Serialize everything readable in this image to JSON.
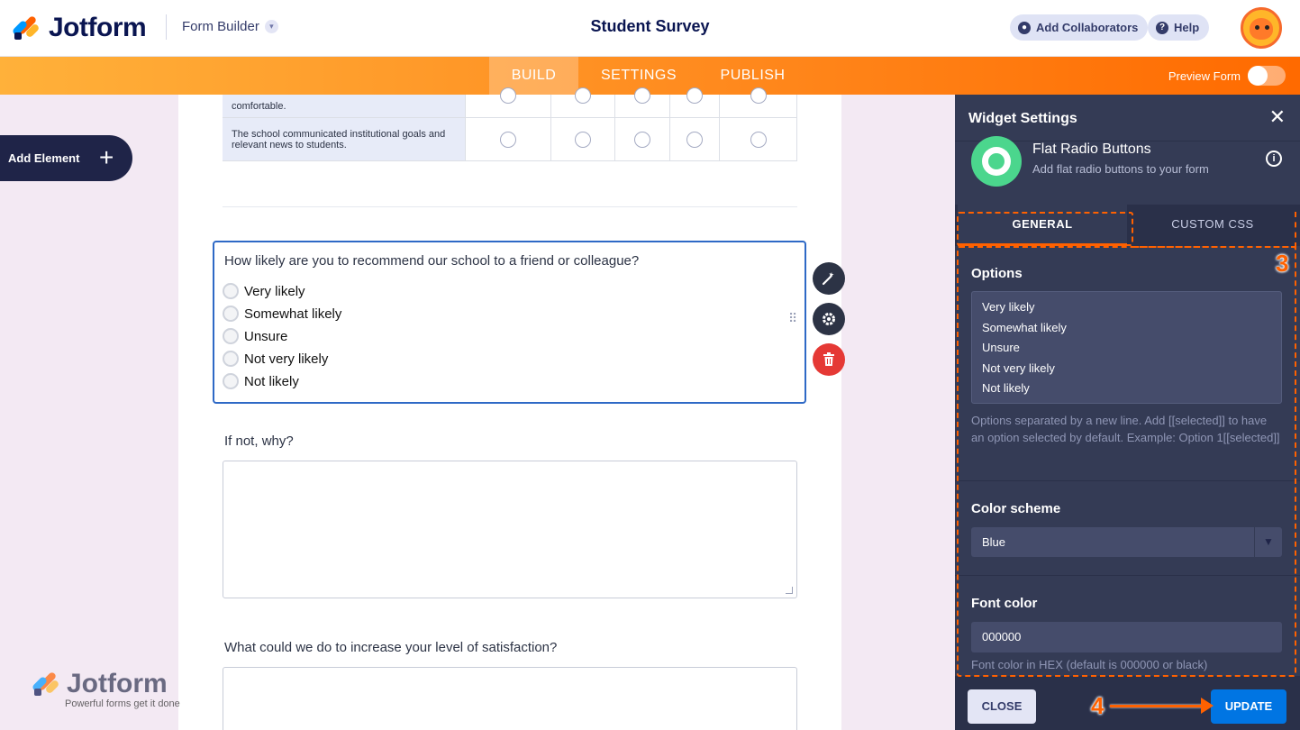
{
  "header": {
    "brand": "Jotform",
    "builder_label": "Form Builder",
    "form_title": "Student Survey",
    "add_collaborators": "Add Collaborators",
    "help": "Help"
  },
  "nav": {
    "build": "BUILD",
    "settings": "SETTINGS",
    "publish": "PUBLISH",
    "preview_form": "Preview Form"
  },
  "left_rail": {
    "add_element": "Add Element"
  },
  "form": {
    "matrix_rows": [
      "comfortable.",
      "The school communicated institutional goals and relevant news to students."
    ],
    "question": "How likely are you to recommend our school to a friend or colleague?",
    "options": [
      "Very likely",
      "Somewhat likely",
      "Unsure",
      "Not very likely",
      "Not likely"
    ],
    "q_if_not": "If not, why?",
    "q_increase": "What could we do to increase your level of satisfaction?"
  },
  "watermark": {
    "brand": "Jotform",
    "tagline": "Powerful forms get it done"
  },
  "panel": {
    "title": "Widget Settings",
    "widget_name": "Flat Radio Buttons",
    "widget_desc": "Add flat radio buttons to your form",
    "tab_general": "GENERAL",
    "tab_css": "CUSTOM CSS",
    "options_label": "Options",
    "options_values": [
      "Very likely",
      "Somewhat likely",
      "Unsure",
      "Not very likely",
      "Not likely"
    ],
    "options_help": "Options separated by a new line. Add [[selected]] to have an option selected by default. Example: Option 1[[selected]]",
    "color_scheme_label": "Color scheme",
    "color_scheme_value": "Blue",
    "font_color_label": "Font color",
    "font_color_value": "000000",
    "font_color_help": "Font color in HEX (default is 000000 or black)",
    "close": "CLOSE",
    "update": "UPDATE"
  },
  "annotations": {
    "step3": "3",
    "step4": "4"
  },
  "colors": {
    "accent": "#ff6100",
    "panel_bg": "#343b55",
    "update_btn": "#0075e3",
    "selection": "#2e69c6"
  }
}
